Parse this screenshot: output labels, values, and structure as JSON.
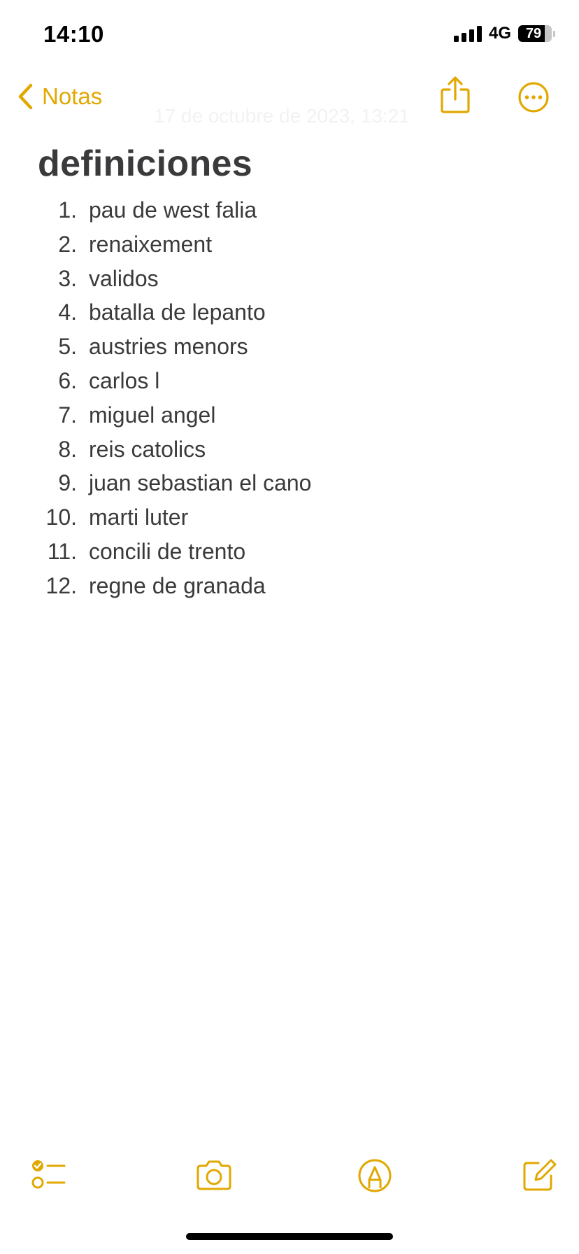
{
  "status_bar": {
    "time": "14:10",
    "network": "4G",
    "battery_level": "79",
    "battery_fraction": 0.79
  },
  "nav": {
    "back_label": "Notas",
    "back_icon": "chevron-left-icon",
    "share_icon": "share-icon",
    "more_icon": "ellipsis-circle-icon",
    "subtitle": "17 de octubre de 2023, 13:21"
  },
  "note": {
    "title": "definiciones",
    "items": [
      {
        "num": "1.",
        "text": "pau de west falia"
      },
      {
        "num": "2.",
        "text": "renaixement"
      },
      {
        "num": "3.",
        "text": "validos"
      },
      {
        "num": "4.",
        "text": "batalla de lepanto"
      },
      {
        "num": "5.",
        "text": "austries menors"
      },
      {
        "num": "6.",
        "text": "carlos l"
      },
      {
        "num": "7.",
        "text": "miguel angel"
      },
      {
        "num": "8.",
        "text": "reis catolics"
      },
      {
        "num": "9.",
        "text": "juan sebastian el cano"
      },
      {
        "num": "10.",
        "text": "marti luter"
      },
      {
        "num": "11.",
        "text": "concili de trento"
      },
      {
        "num": "12.",
        "text": "regne de granada"
      }
    ]
  },
  "toolbar": {
    "checklist_icon": "checklist-icon",
    "camera_icon": "camera-icon",
    "markup_icon": "markup-pen-icon",
    "compose_icon": "compose-icon"
  },
  "colors": {
    "accent": "#e1a802",
    "text": "#3a3a3c",
    "background": "#ffffff"
  }
}
